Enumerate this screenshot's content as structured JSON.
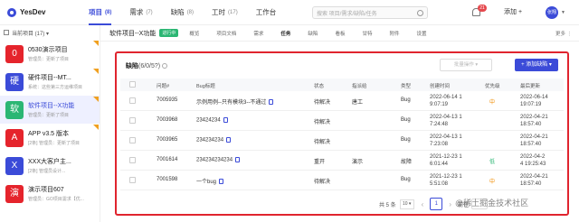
{
  "topbar": {
    "logo": "YesDev",
    "nav": [
      {
        "label": "项目",
        "count": "(8)",
        "active": true
      },
      {
        "label": "需求",
        "count": "(7)",
        "active": false
      },
      {
        "label": "缺陷",
        "count": "(8)",
        "active": false
      },
      {
        "label": "工时",
        "count": "(17)",
        "active": false
      },
      {
        "label": "工作台",
        "count": "",
        "active": false
      }
    ],
    "search_placeholder": "搜索 项目/需求/缺陷/任务",
    "notification_count": "21",
    "add_label": "添加 +",
    "user_label": "张翔"
  },
  "sidebar": {
    "header": "当前项目 (17) ▾",
    "projects": [
      {
        "icon_text": "0",
        "color": "#e5242c",
        "name": "0530演示项目",
        "sub": "管理员：更新了项目",
        "flag": true,
        "active": false
      },
      {
        "icon_text": "硬",
        "color": "#3b4bd8",
        "name": "硬件项目--MT...",
        "sub": "系统：这些第三方运维项目",
        "flag": true,
        "active": false
      },
      {
        "icon_text": "软",
        "color": "#2bb673",
        "name": "软件项目--X功能",
        "sub": "管理员：更新了项目",
        "flag": true,
        "active": true
      },
      {
        "icon_text": "A",
        "color": "#e5242c",
        "name": "APP v3.5 版本",
        "sub": "[2条] 管理员：更新了项目",
        "flag": true,
        "active": false
      },
      {
        "icon_text": "X",
        "color": "#3b4bd8",
        "name": "XXX大客户主...",
        "sub": "[2条] 管理员设计...",
        "flag": false,
        "active": false
      },
      {
        "icon_text": "演",
        "color": "#e5242c",
        "name": "演示项目607",
        "sub": "管理员：GO项目需求【优...",
        "flag": false,
        "active": false
      }
    ]
  },
  "subheader": {
    "title": "软件项目--X功能",
    "status": "进行中",
    "tabs": [
      "概览",
      "项目文档",
      "需求",
      "任务",
      "缺陷",
      "看板",
      "甘特",
      "附件",
      "设置"
    ],
    "active_tab": 3,
    "right": "更多 ⋮"
  },
  "issues": {
    "title": "缺陷",
    "count": "(6/0/5?)",
    "batch_label": "批量操作 ▾",
    "add_label": "+ 添加缺陷 ▾",
    "columns": [
      "问题#",
      "Bug标题",
      "状态",
      "指派给",
      "类型",
      "创建时间",
      "优先级",
      "最后更新"
    ],
    "rows": [
      {
        "id": "7005935",
        "title": "示例用例--只有模块3--不通过",
        "status": "待解决",
        "assignee": "唐工",
        "type": "Bug",
        "created": [
          "2022-06-14 1",
          "9:07:19"
        ],
        "priority": "中",
        "priority_level": "mid",
        "updated": [
          "2022-06-14",
          "19:07:19"
        ]
      },
      {
        "id": "7003968",
        "title": "23424234",
        "status": "待解决",
        "assignee": "",
        "type": "Bug",
        "created": [
          "2022-04-13 1",
          "7:24:48"
        ],
        "priority": "",
        "priority_level": "",
        "updated": [
          "2022-04-21",
          "18:57:40"
        ]
      },
      {
        "id": "7003965",
        "title": "234234234",
        "status": "待解决",
        "assignee": "",
        "type": "Bug",
        "created": [
          "2022-04-13 1",
          "7:23:08"
        ],
        "priority": "",
        "priority_level": "",
        "updated": [
          "2022-04-21",
          "18:57:40"
        ]
      },
      {
        "id": "7001614",
        "title": "234234234234",
        "status": "重开",
        "assignee": "演示",
        "type": "故障",
        "created": [
          "2021-12-23 1",
          "6:01:44"
        ],
        "priority": "低",
        "priority_level": "low",
        "updated": [
          "2022-04-2",
          "4 19:25:43"
        ]
      },
      {
        "id": "7001598",
        "title": "一个bug",
        "status": "待解决",
        "assignee": "",
        "type": "Bug",
        "created": [
          "2021-12-23 1",
          "5:51:08"
        ],
        "priority": "中",
        "priority_level": "mid",
        "updated": [
          "2022-04-21",
          "18:57:40"
        ]
      }
    ],
    "pager": {
      "total": "共 5 条",
      "size": "10 ▾",
      "page": "1",
      "goto": "前往"
    }
  },
  "watermark": "@稀土掘金技术社区"
}
